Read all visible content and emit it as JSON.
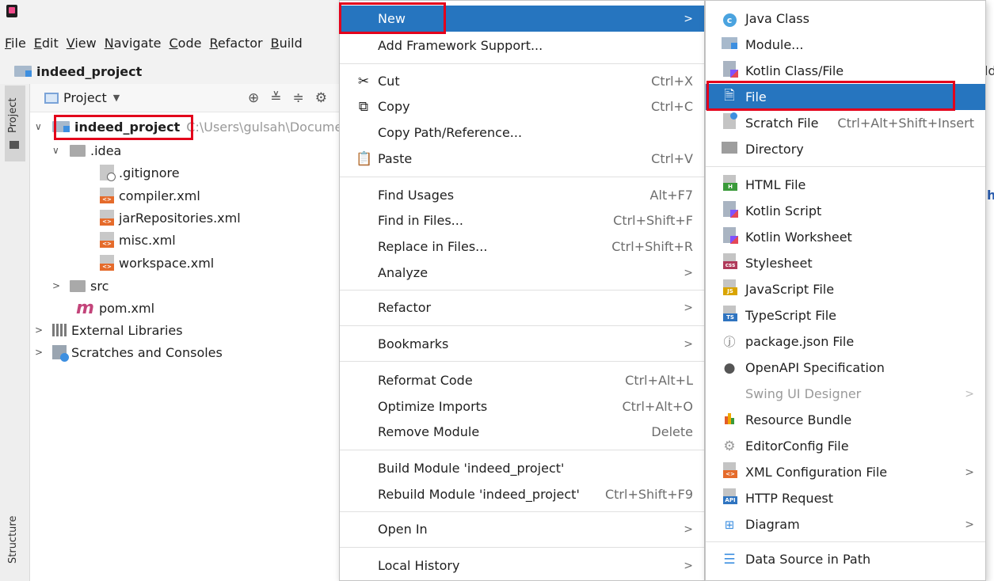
{
  "window": {
    "project_name": "indeed_project"
  },
  "menubar": [
    "File",
    "Edit",
    "View",
    "Navigate",
    "Code",
    "Refactor",
    "Build"
  ],
  "panel": {
    "title": "Project"
  },
  "side_tabs": {
    "project": "Project",
    "structure": "Structure"
  },
  "tree": {
    "root": {
      "label": "indeed_project",
      "path": "C:\\Users\\gulsah\\Docume"
    },
    "idea": ".idea",
    "files": [
      ".gitignore",
      "compiler.xml",
      "jarRepositories.xml",
      "misc.xml",
      "workspace.xml"
    ],
    "src": "src",
    "pom": "pom.xml",
    "external": "External Libraries",
    "scratches": "Scratches and Consoles"
  },
  "context_menu": {
    "new": "New",
    "add_framework": "Add Framework Support...",
    "cut": "Cut",
    "cut_sc": "Ctrl+X",
    "copy": "Copy",
    "copy_sc": "Ctrl+C",
    "copy_path": "Copy Path/Reference...",
    "paste": "Paste",
    "paste_sc": "Ctrl+V",
    "find_usages": "Find Usages",
    "find_usages_sc": "Alt+F7",
    "find_in_files": "Find in Files...",
    "find_in_files_sc": "Ctrl+Shift+F",
    "replace_in_files": "Replace in Files...",
    "replace_in_files_sc": "Ctrl+Shift+R",
    "analyze": "Analyze",
    "refactor": "Refactor",
    "bookmarks": "Bookmarks",
    "reformat": "Reformat Code",
    "reformat_sc": "Ctrl+Alt+L",
    "optimize": "Optimize Imports",
    "optimize_sc": "Ctrl+Alt+O",
    "remove_module": "Remove Module",
    "remove_module_sc": "Delete",
    "build_module": "Build Module 'indeed_project'",
    "rebuild_module": "Rebuild Module 'indeed_project'",
    "rebuild_module_sc": "Ctrl+Shift+F9",
    "open_in": "Open In",
    "local_history": "Local History"
  },
  "submenu": {
    "java_class": "Java Class",
    "module": "Module...",
    "kotlin_class": "Kotlin Class/File",
    "file": "File",
    "scratch": "Scratch File",
    "scratch_sc": "Ctrl+Alt+Shift+Insert",
    "directory": "Directory",
    "html": "HTML File",
    "kotlin_script": "Kotlin Script",
    "kotlin_worksheet": "Kotlin Worksheet",
    "stylesheet": "Stylesheet",
    "javascript": "JavaScript File",
    "typescript": "TypeScript File",
    "package_json": "package.json File",
    "openapi": "OpenAPI Specification",
    "swing": "Swing UI Designer",
    "resource_bundle": "Resource Bundle",
    "editorconfig": "EditorConfig File",
    "xml_config": "XML Configuration File",
    "http_request": "HTTP Request",
    "diagram": "Diagram",
    "data_source": "Data Source in Path"
  },
  "editor_fragments": {
    "top": "ld",
    "mid": "h"
  }
}
